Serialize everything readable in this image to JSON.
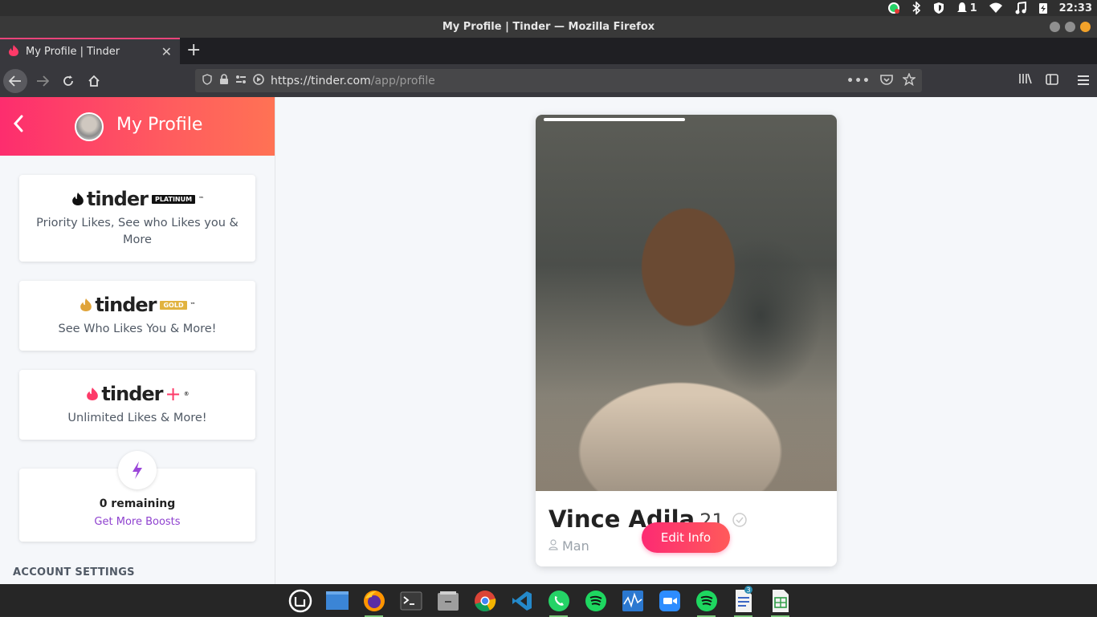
{
  "system_bar": {
    "notifications_count": "1",
    "clock": "22:33"
  },
  "window": {
    "title": "My Profile | Tinder — Mozilla Firefox"
  },
  "tab": {
    "title": "My Profile | Tinder"
  },
  "url": {
    "host": "https://tinder.com",
    "path": "/app/profile"
  },
  "sidebar": {
    "title": "My Profile",
    "cards": [
      {
        "brand": "tinder",
        "badge": "PLATINUM",
        "desc": "Priority Likes, See who Likes you & More"
      },
      {
        "brand": "tinder",
        "badge": "GOLD",
        "desc": "See Who Likes You & More!"
      },
      {
        "brand": "tinder",
        "badge": "+",
        "desc": "Unlimited Likes & More!"
      }
    ],
    "boost": {
      "remaining": "0 remaining",
      "link": "Get More Boosts"
    },
    "section_heading": "ACCOUNT SETTINGS"
  },
  "profile": {
    "name": "Vince Adila",
    "age": "21",
    "gender": "Man",
    "edit_label": "Edit Info"
  },
  "colors": {
    "brand_start": "#fd2d6e",
    "brand_end": "#ff7254",
    "boost_purple": "#8f42cf"
  }
}
